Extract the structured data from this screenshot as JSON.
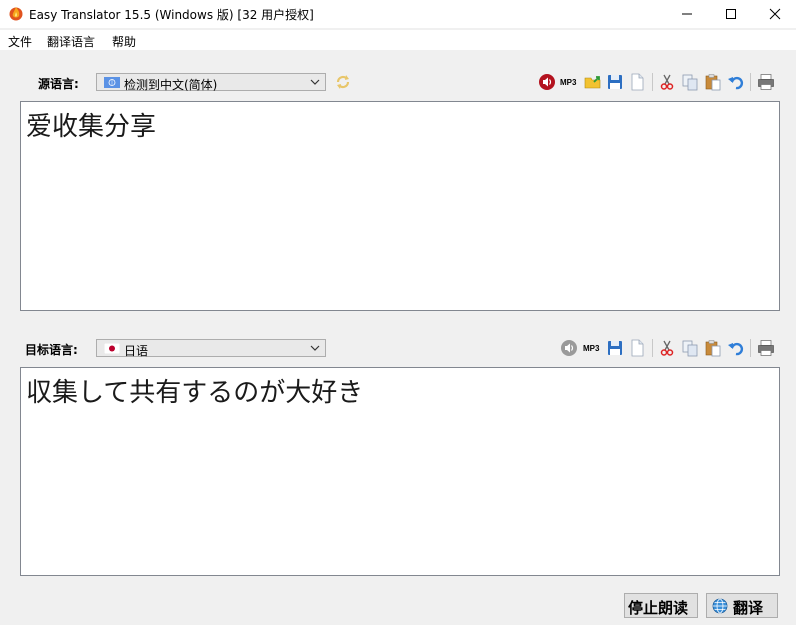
{
  "window": {
    "title": "Easy Translator 15.5 (Windows 版) [32 用户授权]",
    "app_icon": "fire-icon"
  },
  "menu": {
    "items": [
      "文件",
      "翻译语言",
      "帮助"
    ]
  },
  "source": {
    "label": "源语言:",
    "language": "检测到中文(简体)",
    "text": "爱收集分享",
    "toolbar_icons": [
      "speaker-icon",
      "mp3-icon",
      "open-file-icon",
      "save-icon",
      "new-document-icon",
      "cut-icon",
      "copy-icon",
      "paste-icon",
      "undo-icon",
      "print-icon"
    ]
  },
  "target": {
    "label": "目标语言:",
    "language": "日语",
    "text": "収集して共有するのが大好き",
    "toolbar_icons": [
      "speaker-icon",
      "mp3-icon",
      "save-icon",
      "new-document-icon",
      "cut-icon",
      "copy-icon",
      "paste-icon",
      "undo-icon",
      "print-icon"
    ]
  },
  "toolbar": {
    "mp3_label": "MP3"
  },
  "buttons": {
    "stop_reading": "停止朗读",
    "translate": "翻译"
  }
}
